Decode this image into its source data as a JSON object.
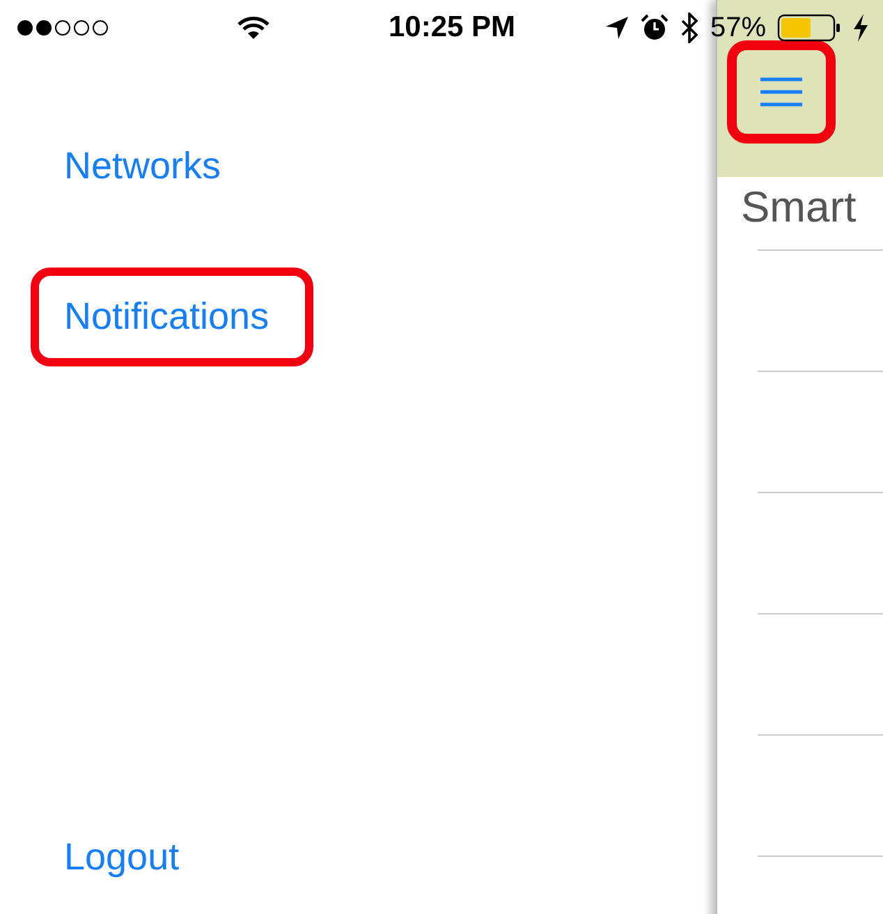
{
  "status_bar": {
    "time": "10:25 PM",
    "battery": "57%"
  },
  "menu": {
    "items": [
      {
        "label": "Networks",
        "highlighted": false
      },
      {
        "label": "Notifications",
        "highlighted": true
      }
    ],
    "footer_item": {
      "label": "Logout",
      "highlighted": false
    }
  },
  "main": {
    "menu_button": {
      "highlighted": true
    },
    "title": "Smart"
  }
}
